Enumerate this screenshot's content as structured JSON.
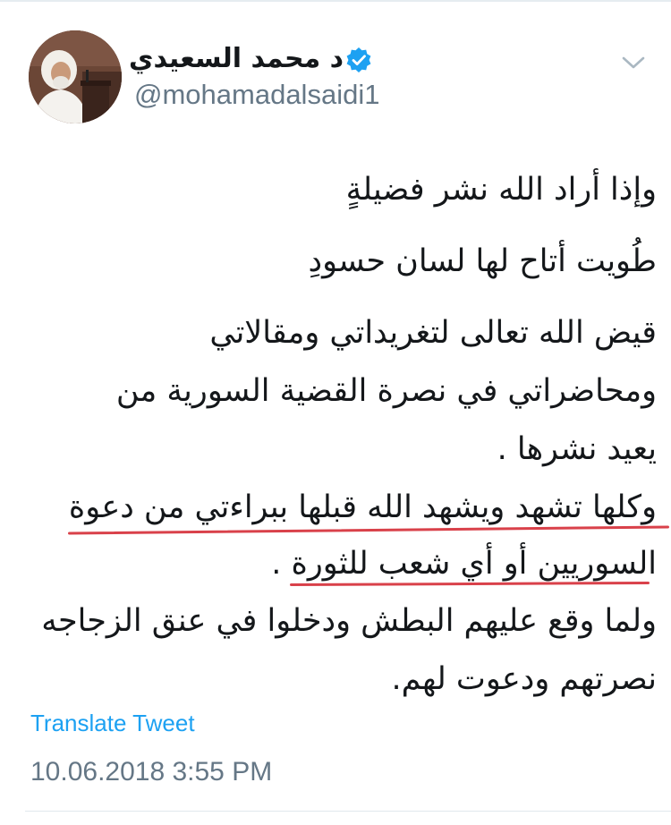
{
  "tweet": {
    "author": {
      "display_name": "د محمد السعيدي",
      "handle": "@mohamadalsaidi1",
      "verified": true
    },
    "icons": {
      "verified": "verified-badge-icon",
      "menu": "chevron-down-icon"
    },
    "lines": [
      "وإذا أراد الله نشر فضيلةٍ",
      "طُويت أتاح لها لسان حسودِ",
      "قيض الله تعالى لتغريداتي ومقالاتي",
      "ومحاضراتي في نصرة القضية السورية من",
      "يعيد نشرها .",
      "وكلها تشهد ويشهد الله قبلها ببراءتي من دعوة",
      "السوريين أو  أي شعب للثورة .",
      "ولما وقع عليهم البطش ودخلوا في عنق الزجاجه",
      "نصرتهم ودعوت لهم."
    ],
    "translate_label": "Translate Tweet",
    "timestamp": "10.06.2018 3:55 PM"
  },
  "colors": {
    "text": "#14171a",
    "secondary": "#657786",
    "link": "#1da1f2",
    "verified": "#1da1f2",
    "annotation_underline": "#d9414a"
  }
}
